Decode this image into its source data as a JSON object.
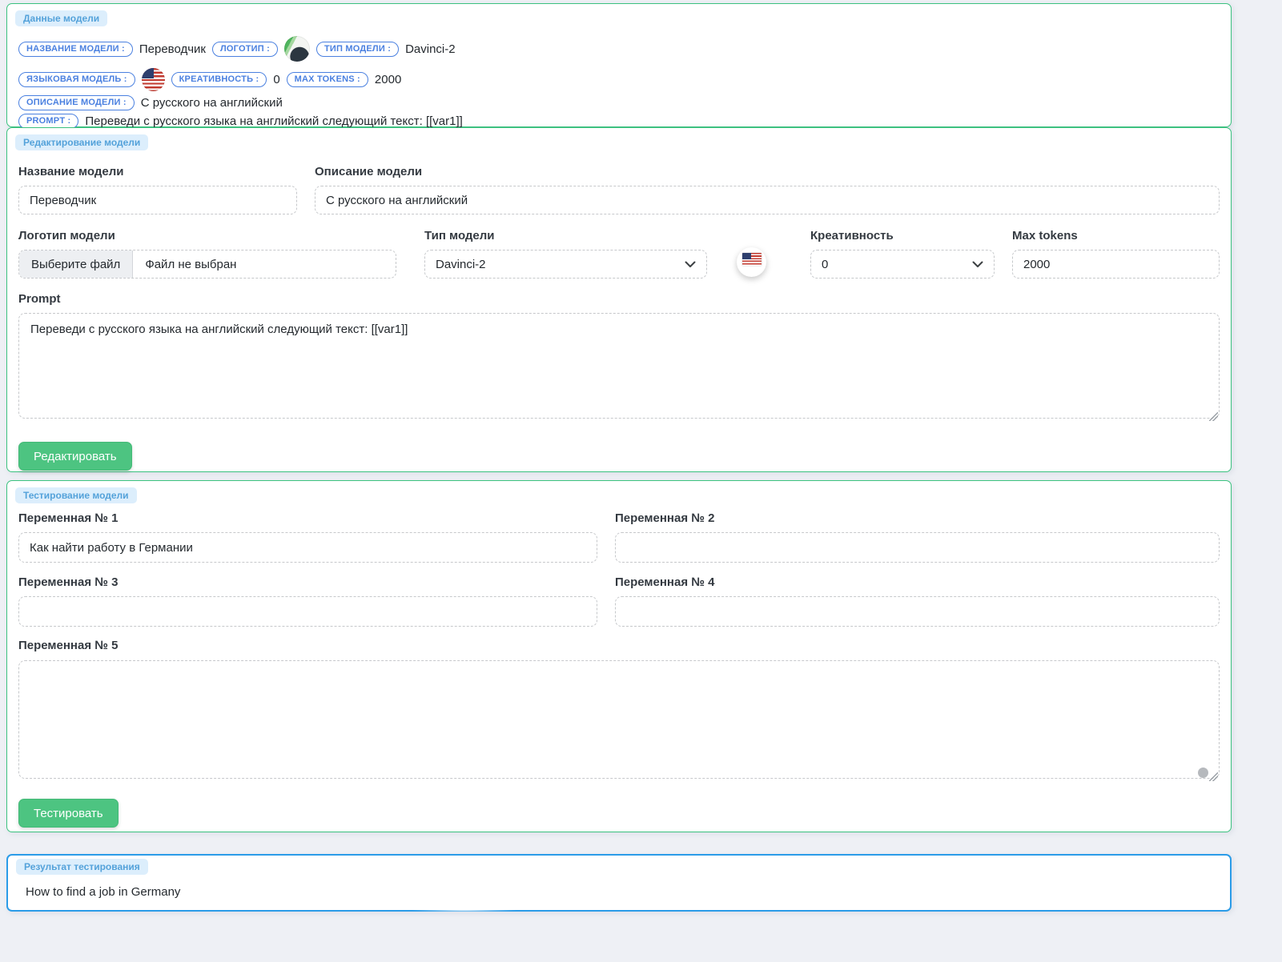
{
  "colors": {
    "page_background": "#eef0f5",
    "panel_border_green": "#3bc27f",
    "result_border_blue": "#2b9ce8",
    "badge_blue": "#4a80e0",
    "tag_background": "#dceefc",
    "tag_text": "#54a2da",
    "button_green": "#4dc481"
  },
  "model_data_panel": {
    "tag": "Данные модели",
    "name_badge": "НАЗВАНИЕ МОДЕЛИ :",
    "name_value": "Переводчик",
    "logo_badge": "ЛОГОТИП :",
    "type_badge": "ТИП МОДЕЛИ :",
    "type_value": "Davinci-2",
    "language_badge": "ЯЗЫКОВАЯ МОДЕЛЬ :",
    "creativity_badge": "КРЕАТИВНОСТЬ :",
    "creativity_value": "0",
    "max_tokens_badge": "MAX TOKENS :",
    "max_tokens_value": "2000",
    "description_badge": "ОПИСАНИЕ МОДЕЛИ :",
    "description_value": "С русского на английский",
    "prompt_badge": "PROMPT :",
    "prompt_value": "Переведи с русского языка на английский следующий текст: [[var1]]"
  },
  "edit_panel": {
    "tag": "Редактирование модели",
    "name_label": "Название модели",
    "name_value": "Переводчик",
    "description_label": "Описание модели",
    "description_value": "С русского на английский",
    "logo_label": "Логотип модели",
    "file_button_label": "Выберите файл",
    "file_status": "Файл не выбран",
    "type_label": "Тип модели",
    "type_value": "Davinci-2",
    "creativity_label": "Креативность",
    "creativity_value": "0",
    "max_tokens_label": "Max tokens",
    "max_tokens_value": "2000",
    "prompt_label": "Prompt",
    "prompt_value": "Переведи с русского языка на английский следующий текст: [[var1]]",
    "submit_label": "Редактировать"
  },
  "test_panel": {
    "tag": "Тестирование модели",
    "var1_label": "Переменная № 1",
    "var1_value": "Как найти работу в Германии",
    "var2_label": "Переменная № 2",
    "var2_value": "",
    "var3_label": "Переменная № 3",
    "var3_value": "",
    "var4_label": "Переменная № 4",
    "var4_value": "",
    "var5_label": "Переменная № 5",
    "var5_value": "",
    "submit_label": "Тестировать"
  },
  "result_panel": {
    "tag": "Результат тестирования",
    "result_text": "How to find a job in Germany"
  }
}
